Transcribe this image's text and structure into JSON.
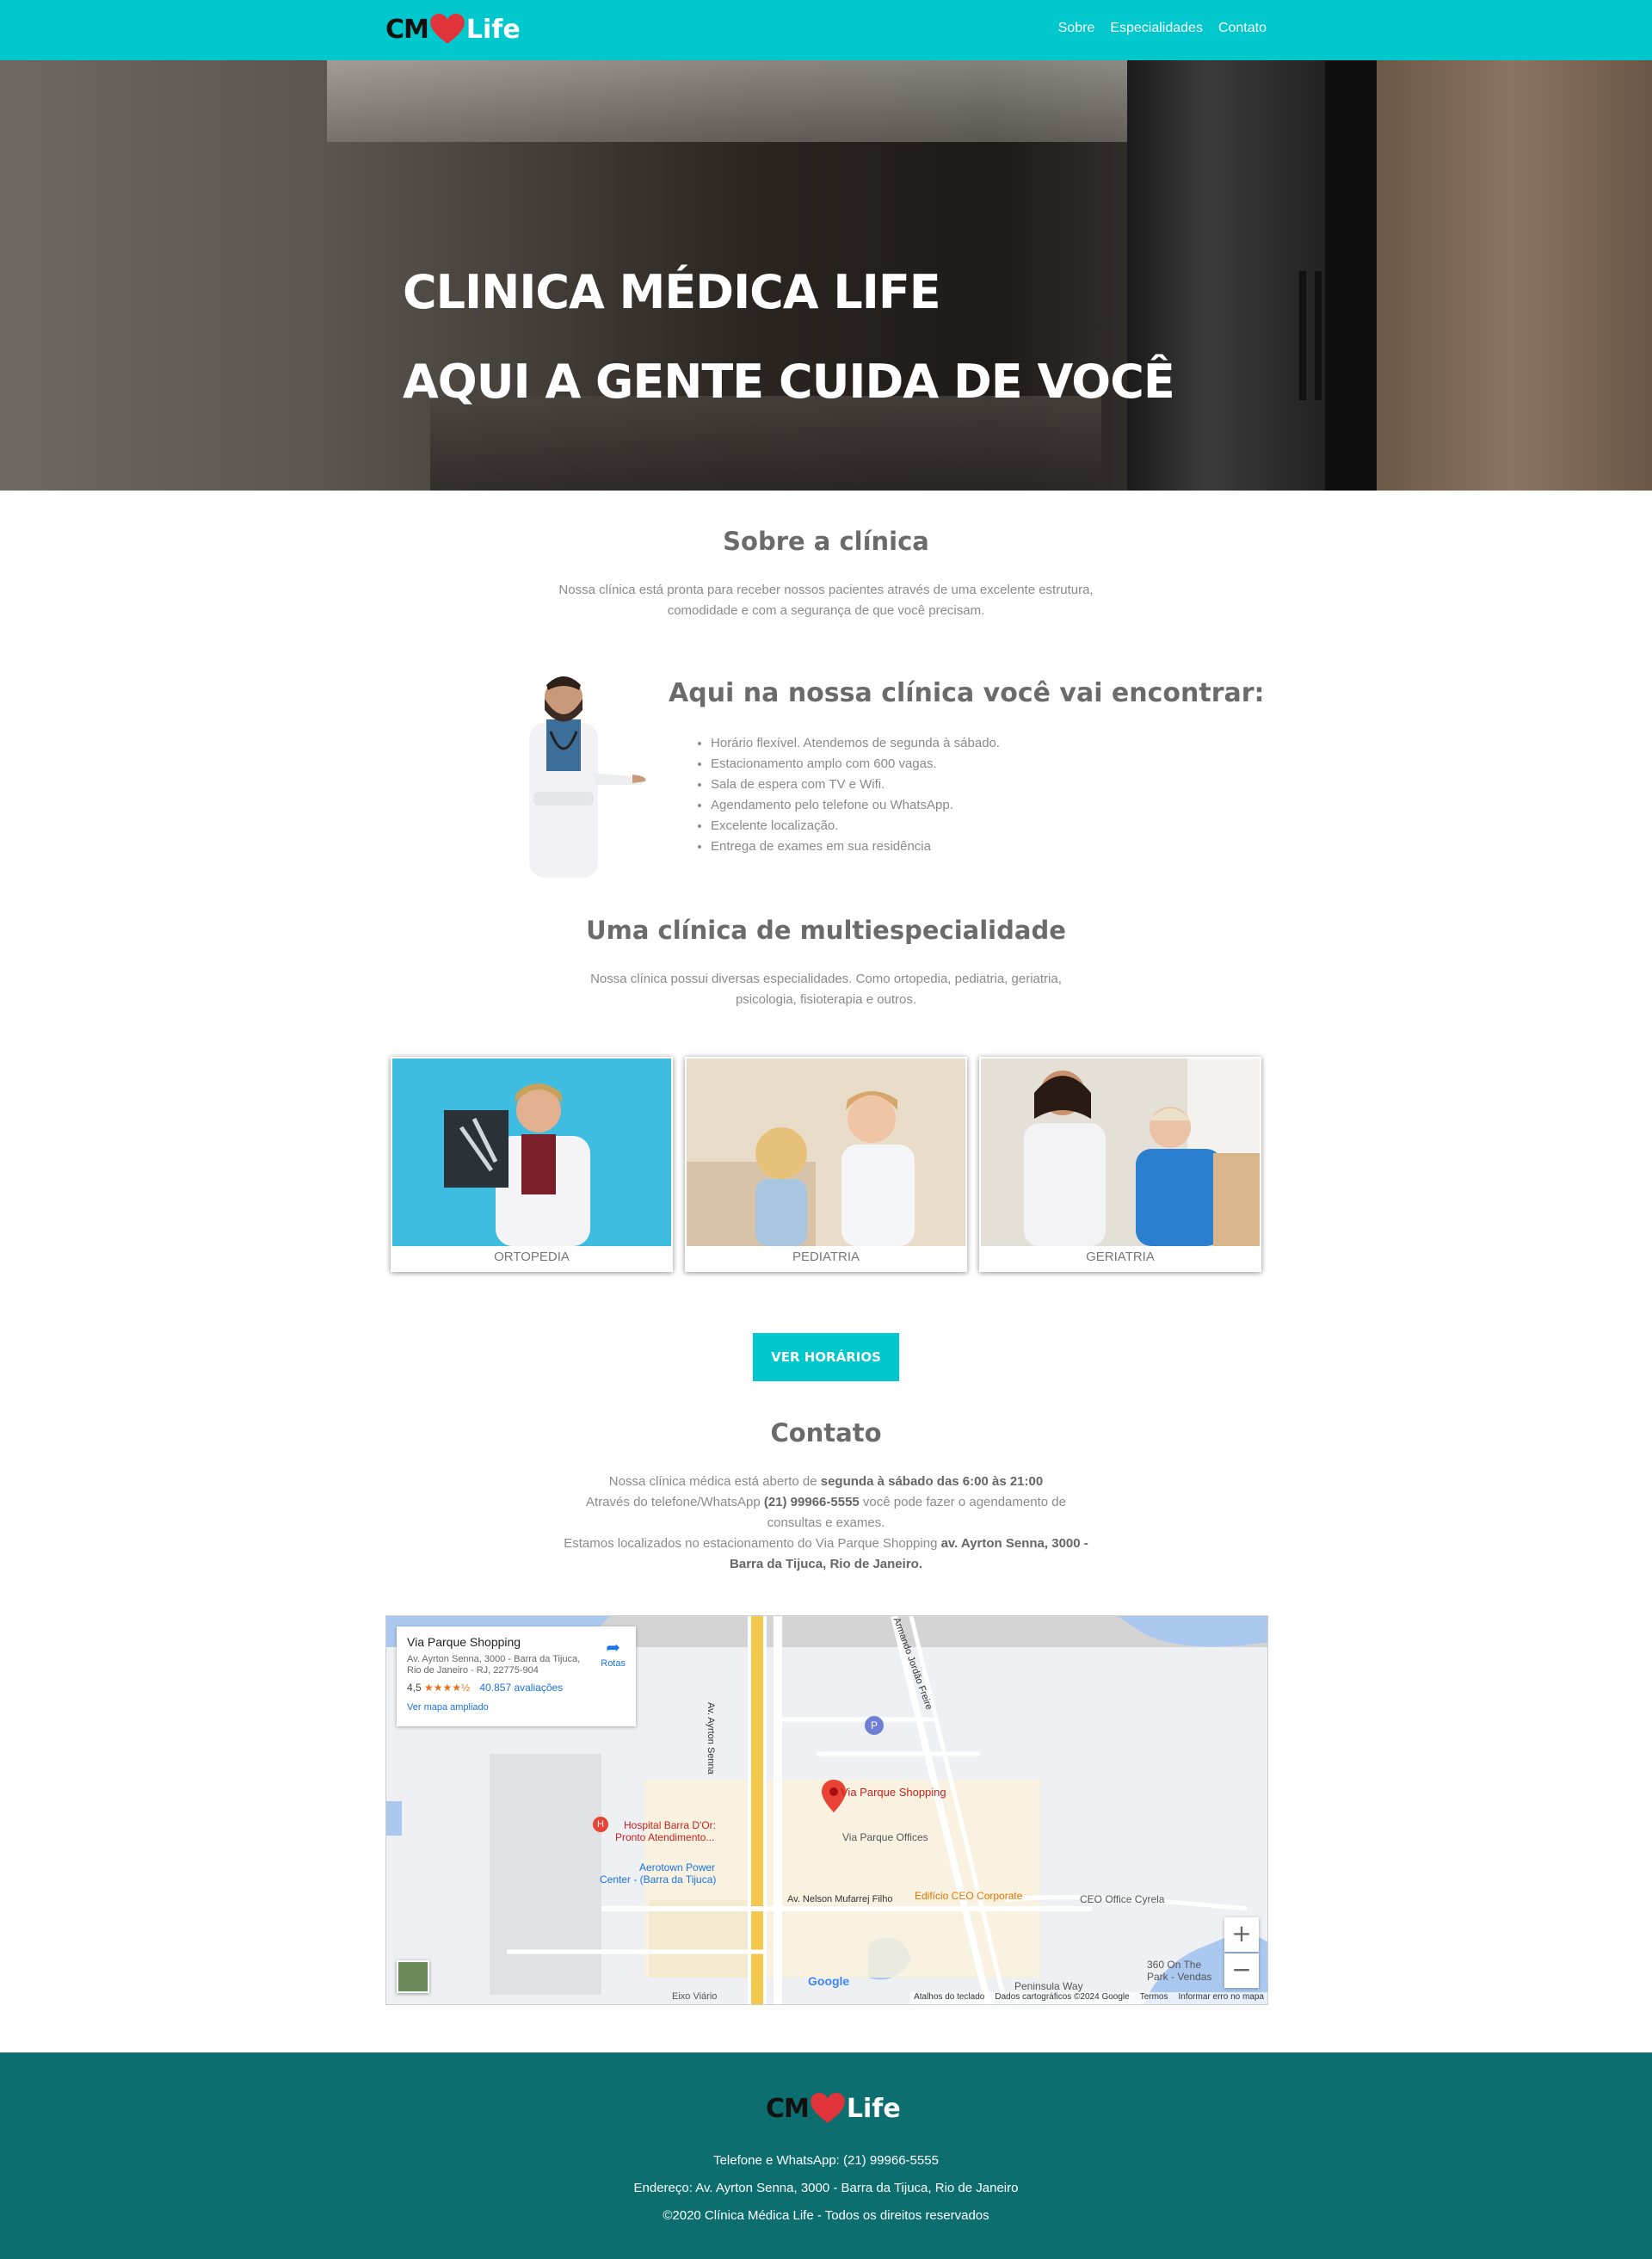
{
  "nav": {
    "logo": {
      "left": "CM",
      "right": "Life"
    },
    "links": [
      "Sobre",
      "Especialidades",
      "Contato"
    ]
  },
  "hero": {
    "line1": "CLINICA MÉDICA LIFE",
    "line2": "AQUI A GENTE CUIDA DE VOCÊ"
  },
  "about": {
    "title": "Sobre a clínica",
    "text_l1": "Nossa clínica está pronta para receber nossos pacientes através de uma excelente estrutura,",
    "text_l2": "comodidade e com a segurança de que você precisam."
  },
  "features": {
    "title": "Aqui na nossa clínica você vai encontrar:",
    "items": [
      "Horário flexível. Atendemos de segunda à sábado.",
      "Estacionamento amplo com 600 vagas.",
      "Sala de espera com TV e Wifi.",
      "Agendamento pelo telefone ou WhatsApp.",
      "Excelente localização.",
      "Entrega de exames em sua residência"
    ]
  },
  "specialties": {
    "title": "Uma clínica de multiespecialidade",
    "text_l1": "Nossa clínica possui diversas especialidades. Como ortopedia, pediatria, geriatria,",
    "text_l2": "psicologia, fisioterapia e outros.",
    "cards": [
      "ORTOPEDIA",
      "PEDIATRIA",
      "GERIATRIA"
    ],
    "button": "VER HORÁRIOS"
  },
  "contact": {
    "title": "Contato",
    "l1_a": "Nossa clínica médica está aberto de ",
    "l1_b": "segunda à sábado das 6:00 às 21:00",
    "l2_a": "Através do telefone/WhatsApp ",
    "l2_b": "(21) 99966-5555",
    "l2_c": " você pode fazer o agendamento de",
    "l3": "consultas e exames.",
    "l4_a": "Estamos localizados no estacionamento do Via Parque Shopping ",
    "l4_b": "av. Ayrton Senna, 3000 -",
    "l5": "Barra da Tijuca, Rio de Janeiro."
  },
  "map": {
    "place": "Via Parque Shopping",
    "address": "Av. Ayrton Senna, 3000 - Barra da Tijuca, Rio de Janeiro - RJ, 22775-904",
    "rating": "4,5",
    "stars": "★★★★½",
    "reviews": "40.857 avaliações",
    "link": "Ver mapa ampliado",
    "route": "Rotas",
    "labels": {
      "pin": "Via Parque Shopping",
      "offices": "Via Parque Offices",
      "hospital1": "Hospital Barra D'Or:",
      "hospital2": "Pronto Atendimento...",
      "aero1": "Aerotown Power",
      "aero2": "Center - (Barra da Tijuca)",
      "nelson": "Av. Nelson Mufarrej Filho",
      "ceo": "Edifício CEO Corporate",
      "cyrela": "CEO Office Cyrela",
      "ayrton": "Av. Ayrton Senna",
      "jordao": "Armando Jordão Freire",
      "eixo": "Eixo Viário",
      "park1": "360 On The",
      "park2": "Park - Vendas",
      "peninsula": "Peninsula Way",
      "google": "Google",
      "p_icon": "P"
    },
    "footer": [
      "Atalhos do teclado",
      "Dados cartográficos ©2024 Google",
      "Termos",
      "Informar erro no mapa"
    ],
    "zoom_in": "+",
    "zoom_out": "−"
  },
  "footer": {
    "logo": {
      "left": "CM",
      "right": "Life"
    },
    "phone": "Telefone e WhatsApp: (21) 99966-5555",
    "address": "Endereço: Av. Ayrton Senna, 3000 - Barra da Tijuca, Rio de Janeiro",
    "copyright": "©2020 Clínica Médica Life - Todos os direitos reservados"
  },
  "colors": {
    "accent": "#00c8cc",
    "footer": "#0c6e6e",
    "heart": "#e0343a"
  }
}
